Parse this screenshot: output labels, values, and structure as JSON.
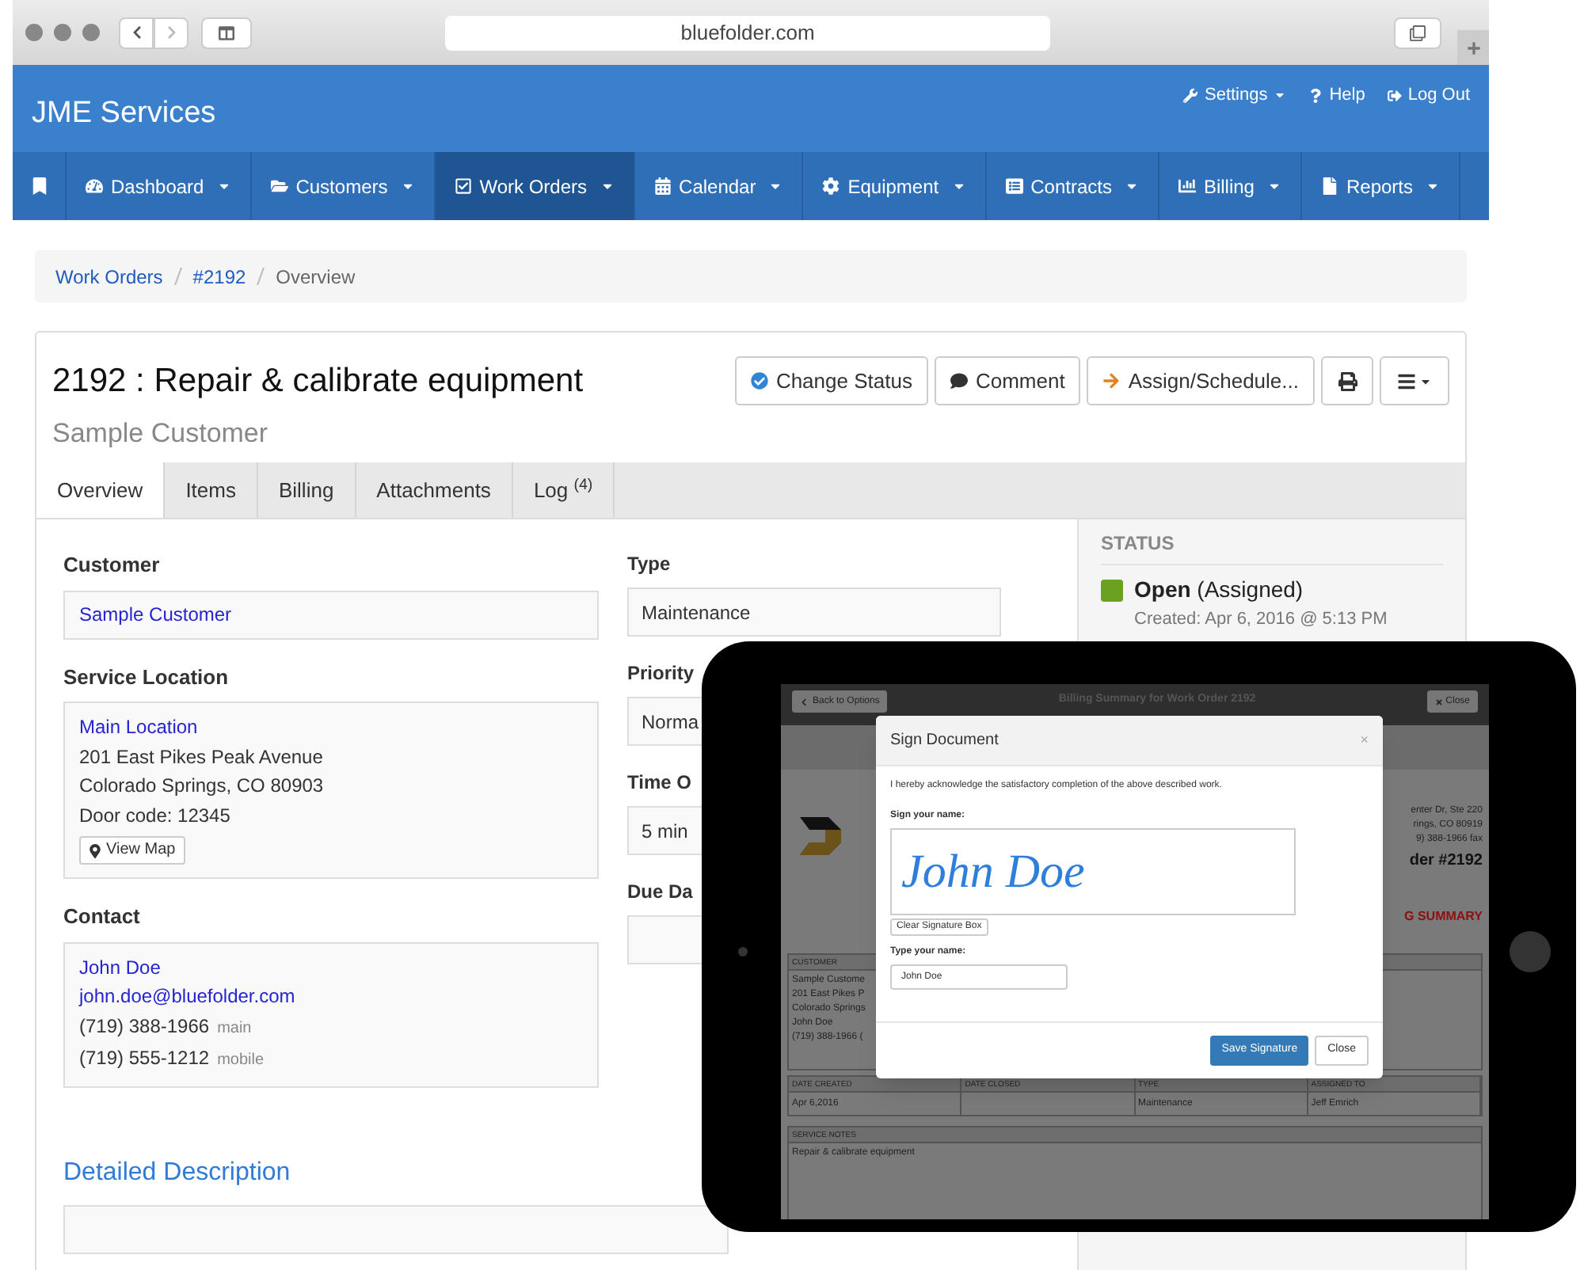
{
  "browser": {
    "url": "bluefolder.com"
  },
  "app": {
    "name": "JME Services"
  },
  "top_links": [
    {
      "label": "Settings",
      "kind": "settings",
      "has_menu": true
    },
    {
      "label": "Help",
      "kind": "help",
      "has_menu": false
    },
    {
      "label": "Log Out",
      "kind": "logout",
      "has_menu": false
    }
  ],
  "nav": [
    {
      "label": "Dashboard",
      "selected": false
    },
    {
      "label": "Customers",
      "selected": false
    },
    {
      "label": "Work Orders",
      "selected": true
    },
    {
      "label": "Calendar",
      "selected": false
    },
    {
      "label": "Equipment",
      "selected": false
    },
    {
      "label": "Contracts",
      "selected": false
    },
    {
      "label": "Billing",
      "selected": false
    },
    {
      "label": "Reports",
      "selected": false
    }
  ],
  "breadcrumb": [
    {
      "label": "Work Orders",
      "kind": "link"
    },
    {
      "label": "#2192",
      "kind": "link"
    },
    {
      "label": "Overview",
      "kind": "current"
    }
  ],
  "work_order": {
    "title": "2192 : Repair & calibrate equipment",
    "customer": "Sample Customer"
  },
  "actions": [
    {
      "label": "Change Status",
      "kind": "status"
    },
    {
      "label": "Comment",
      "kind": "comment"
    },
    {
      "label": "Assign/Schedule...",
      "kind": "assign"
    }
  ],
  "tabs": [
    {
      "label": "Overview",
      "selected": true
    },
    {
      "label": "Items",
      "selected": false
    },
    {
      "label": "Billing",
      "selected": false
    },
    {
      "label": "Attachments",
      "selected": false
    },
    {
      "label": "Log $^{(4)}$",
      "selected": false
    }
  ],
  "customer": {
    "label": "Customer",
    "value": "Sample Customer"
  },
  "service_location": {
    "label": "Service Location",
    "name": "Main Location",
    "lines": [
      "201 East Pikes Peak Avenue",
      "Colorado Springs, CO 80903",
      "Door code: 12345"
    ],
    "map_button": "View Map"
  },
  "contact": {
    "label": "Contact",
    "name": "John Doe",
    "email": "john.doe@bluefolder.com",
    "phones": [
      {
        "number": "(719) 388-1966",
        "tag": "main"
      },
      {
        "number": "(719) 555-1212",
        "tag": "mobile"
      }
    ]
  },
  "fields_right": [
    {
      "label": "Type",
      "value": "Maintenance"
    },
    {
      "label": "Priority",
      "value": "Norma"
    },
    {
      "label": "Time O",
      "value": "5 min"
    },
    {
      "label": "Due Da"
    }
  ],
  "status": {
    "heading": "STATUS",
    "state": "Open",
    "detail": "(Assigned)",
    "color": "#6aa121",
    "created": "Created: Apr 6, 2016 @ 5:13 PM"
  },
  "description": {
    "heading": "Detailed Description"
  },
  "tablet": {
    "back_button": "Back to Options",
    "page_title": "Billing Summary for Work Order 2192",
    "close_button": "Close",
    "company_lines": [
      "enter Dr, Ste 220",
      "rings, CO 80919",
      "9) 388-1966 fax"
    ],
    "order_heading": "der #2192",
    "summary_heading": "G SUMMARY",
    "customer_heading": "CUSTOMER",
    "customer_lines": [
      "Sample Custome",
      "201 East Pikes P",
      "Colorado Springs",
      "John Doe",
      "(719) 388-1966 ("
    ],
    "table_columns": [
      "DATE CREATED",
      "DATE CLOSED",
      "TYPE",
      "ASSIGNED TO"
    ],
    "table_row": {
      "date_created": "Apr 6,2016",
      "type": "Maintenance",
      "assigned_to": "Jeff Emrich"
    },
    "notes_heading": "SERVICE NOTES",
    "notes": "Repair & calibrate equipment",
    "modal": {
      "title": "Sign Document",
      "close": "×",
      "message": "I hereby acknowledge the satisfactory completion of the above described work.",
      "sign_label": "Sign your name:",
      "signature": "John Doe",
      "clear_button": "Clear Signature Box",
      "name_label": "Type your name:",
      "name_value": "John Doe",
      "save_button": "Save Signature",
      "cancel_button": "Close"
    }
  }
}
